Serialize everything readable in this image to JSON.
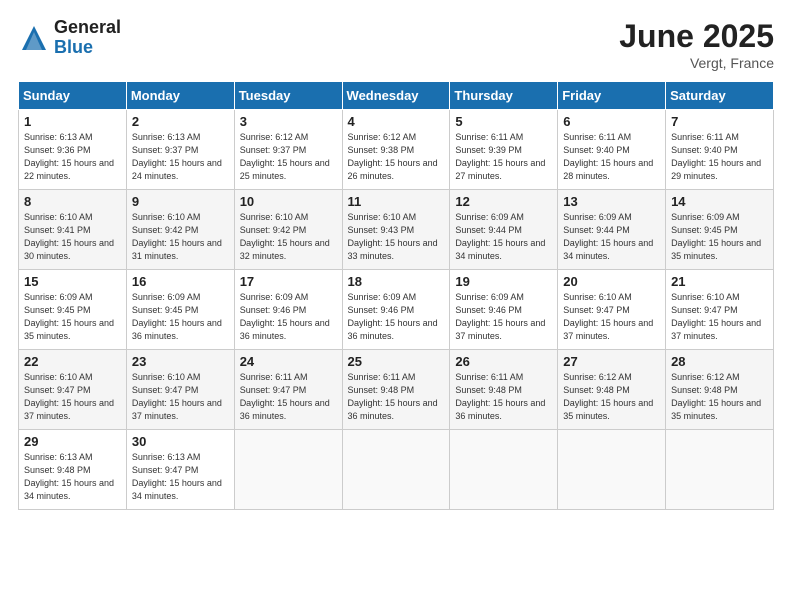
{
  "logo": {
    "general": "General",
    "blue": "Blue"
  },
  "title": "June 2025",
  "location": "Vergt, France",
  "days_header": [
    "Sunday",
    "Monday",
    "Tuesday",
    "Wednesday",
    "Thursday",
    "Friday",
    "Saturday"
  ],
  "weeks": [
    [
      {
        "num": "1",
        "sunrise": "6:13 AM",
        "sunset": "9:36 PM",
        "daylight": "15 hours and 22 minutes."
      },
      {
        "num": "2",
        "sunrise": "6:13 AM",
        "sunset": "9:37 PM",
        "daylight": "15 hours and 24 minutes."
      },
      {
        "num": "3",
        "sunrise": "6:12 AM",
        "sunset": "9:37 PM",
        "daylight": "15 hours and 25 minutes."
      },
      {
        "num": "4",
        "sunrise": "6:12 AM",
        "sunset": "9:38 PM",
        "daylight": "15 hours and 26 minutes."
      },
      {
        "num": "5",
        "sunrise": "6:11 AM",
        "sunset": "9:39 PM",
        "daylight": "15 hours and 27 minutes."
      },
      {
        "num": "6",
        "sunrise": "6:11 AM",
        "sunset": "9:40 PM",
        "daylight": "15 hours and 28 minutes."
      },
      {
        "num": "7",
        "sunrise": "6:11 AM",
        "sunset": "9:40 PM",
        "daylight": "15 hours and 29 minutes."
      }
    ],
    [
      {
        "num": "8",
        "sunrise": "6:10 AM",
        "sunset": "9:41 PM",
        "daylight": "15 hours and 30 minutes."
      },
      {
        "num": "9",
        "sunrise": "6:10 AM",
        "sunset": "9:42 PM",
        "daylight": "15 hours and 31 minutes."
      },
      {
        "num": "10",
        "sunrise": "6:10 AM",
        "sunset": "9:42 PM",
        "daylight": "15 hours and 32 minutes."
      },
      {
        "num": "11",
        "sunrise": "6:10 AM",
        "sunset": "9:43 PM",
        "daylight": "15 hours and 33 minutes."
      },
      {
        "num": "12",
        "sunrise": "6:09 AM",
        "sunset": "9:44 PM",
        "daylight": "15 hours and 34 minutes."
      },
      {
        "num": "13",
        "sunrise": "6:09 AM",
        "sunset": "9:44 PM",
        "daylight": "15 hours and 34 minutes."
      },
      {
        "num": "14",
        "sunrise": "6:09 AM",
        "sunset": "9:45 PM",
        "daylight": "15 hours and 35 minutes."
      }
    ],
    [
      {
        "num": "15",
        "sunrise": "6:09 AM",
        "sunset": "9:45 PM",
        "daylight": "15 hours and 35 minutes."
      },
      {
        "num": "16",
        "sunrise": "6:09 AM",
        "sunset": "9:45 PM",
        "daylight": "15 hours and 36 minutes."
      },
      {
        "num": "17",
        "sunrise": "6:09 AM",
        "sunset": "9:46 PM",
        "daylight": "15 hours and 36 minutes."
      },
      {
        "num": "18",
        "sunrise": "6:09 AM",
        "sunset": "9:46 PM",
        "daylight": "15 hours and 36 minutes."
      },
      {
        "num": "19",
        "sunrise": "6:09 AM",
        "sunset": "9:46 PM",
        "daylight": "15 hours and 37 minutes."
      },
      {
        "num": "20",
        "sunrise": "6:10 AM",
        "sunset": "9:47 PM",
        "daylight": "15 hours and 37 minutes."
      },
      {
        "num": "21",
        "sunrise": "6:10 AM",
        "sunset": "9:47 PM",
        "daylight": "15 hours and 37 minutes."
      }
    ],
    [
      {
        "num": "22",
        "sunrise": "6:10 AM",
        "sunset": "9:47 PM",
        "daylight": "15 hours and 37 minutes."
      },
      {
        "num": "23",
        "sunrise": "6:10 AM",
        "sunset": "9:47 PM",
        "daylight": "15 hours and 37 minutes."
      },
      {
        "num": "24",
        "sunrise": "6:11 AM",
        "sunset": "9:47 PM",
        "daylight": "15 hours and 36 minutes."
      },
      {
        "num": "25",
        "sunrise": "6:11 AM",
        "sunset": "9:48 PM",
        "daylight": "15 hours and 36 minutes."
      },
      {
        "num": "26",
        "sunrise": "6:11 AM",
        "sunset": "9:48 PM",
        "daylight": "15 hours and 36 minutes."
      },
      {
        "num": "27",
        "sunrise": "6:12 AM",
        "sunset": "9:48 PM",
        "daylight": "15 hours and 35 minutes."
      },
      {
        "num": "28",
        "sunrise": "6:12 AM",
        "sunset": "9:48 PM",
        "daylight": "15 hours and 35 minutes."
      }
    ],
    [
      {
        "num": "29",
        "sunrise": "6:13 AM",
        "sunset": "9:48 PM",
        "daylight": "15 hours and 34 minutes."
      },
      {
        "num": "30",
        "sunrise": "6:13 AM",
        "sunset": "9:47 PM",
        "daylight": "15 hours and 34 minutes."
      },
      null,
      null,
      null,
      null,
      null
    ]
  ]
}
